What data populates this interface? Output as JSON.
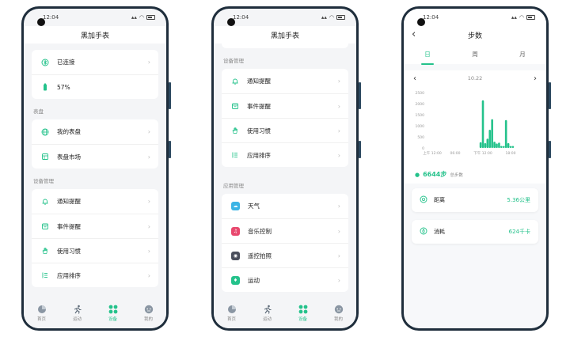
{
  "colors": {
    "accent": "#24c28b",
    "frame": "#1f2e3c",
    "bg": "#f4f5f7"
  },
  "phone1": {
    "time": "12:04",
    "title": "黑加手表",
    "status_card": [
      {
        "icon": "bluetooth-icon",
        "label": "已连接"
      },
      {
        "icon": "battery-icon",
        "label": "57%"
      }
    ],
    "section_watchface": "表盘",
    "watchface_items": [
      {
        "icon": "globe-icon",
        "label": "我的表盘"
      },
      {
        "icon": "store-icon",
        "label": "表盘市场"
      }
    ],
    "section_device": "设备管理",
    "device_items": [
      {
        "icon": "bell-icon",
        "label": "通知提醒"
      },
      {
        "icon": "calendar-icon",
        "label": "事件提醒"
      },
      {
        "icon": "hand-icon",
        "label": "使用习惯"
      },
      {
        "icon": "sort-icon",
        "label": "应用排序"
      }
    ],
    "tabs": [
      {
        "icon": "home-icon",
        "label": "首页"
      },
      {
        "icon": "run-icon",
        "label": "运动"
      },
      {
        "icon": "device-icon",
        "label": "设备"
      },
      {
        "icon": "profile-icon",
        "label": "我的"
      }
    ]
  },
  "phone2": {
    "time": "12:04",
    "title": "黑加手表",
    "section_device": "设备管理",
    "device_items": [
      {
        "icon": "bell-icon",
        "label": "通知提醒"
      },
      {
        "icon": "calendar-icon",
        "label": "事件提醒"
      },
      {
        "icon": "hand-icon",
        "label": "使用习惯"
      },
      {
        "icon": "sort-icon",
        "label": "应用排序"
      }
    ],
    "section_apps": "应用管理",
    "app_items": [
      {
        "icon": "weather-icon",
        "label": "天气",
        "color": "#3bb4e5"
      },
      {
        "icon": "music-icon",
        "label": "音乐控制",
        "color": "#e8486e"
      },
      {
        "icon": "camera-icon",
        "label": "遥控拍照",
        "color": "#4a4f5c"
      },
      {
        "icon": "sport-icon",
        "label": "运动",
        "color": "#24c28b"
      }
    ],
    "tabs": [
      {
        "icon": "home-icon",
        "label": "首页"
      },
      {
        "icon": "run-icon",
        "label": "运动"
      },
      {
        "icon": "device-icon",
        "label": "设备"
      },
      {
        "icon": "profile-icon",
        "label": "我的"
      }
    ]
  },
  "phone3": {
    "time": "12:04",
    "title": "步数",
    "back": "‹",
    "segments": [
      "日",
      "周",
      "月"
    ],
    "date": "10.22",
    "steps_value": "6644步",
    "steps_unit": "总步数",
    "metrics": [
      {
        "icon": "distance-icon",
        "label": "距离",
        "value": "5.36公里"
      },
      {
        "icon": "calorie-icon",
        "label": "消耗",
        "value": "624千卡"
      }
    ]
  },
  "chart_data": {
    "type": "bar",
    "ylim": [
      0,
      2500
    ],
    "y_ticks": [
      "0",
      "500",
      "1000",
      "1500",
      "2000",
      "2500"
    ],
    "x_tick_labels": [
      "上午 12:00",
      "06:00",
      "下午 12:00",
      "18:00"
    ],
    "x": [
      11.5,
      12,
      12.5,
      13,
      13.5,
      14,
      14.5,
      15,
      15.5,
      16,
      16.5,
      17,
      17.5,
      18,
      18.5
    ],
    "values": [
      260,
      2150,
      220,
      420,
      820,
      1300,
      280,
      200,
      240,
      0,
      0,
      1260,
      220,
      0,
      0
    ],
    "xlim": [
      0,
      24
    ]
  }
}
